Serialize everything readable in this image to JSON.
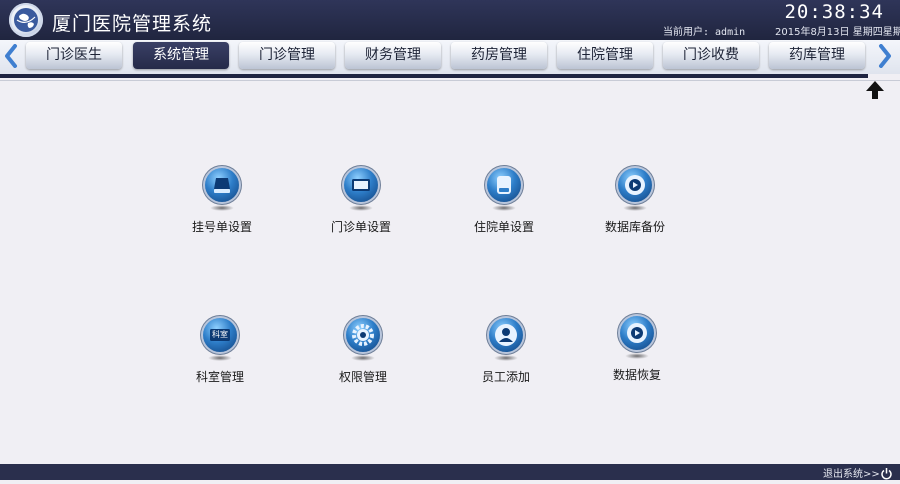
{
  "header": {
    "title": "厦门医院管理系统",
    "clock": "20:38:34",
    "user_info": "当前用户:  admin",
    "date_info": "2015年8月13日  星期四星期"
  },
  "nav": {
    "tabs": [
      {
        "label": "门诊医生",
        "active": false
      },
      {
        "label": "系统管理",
        "active": true
      },
      {
        "label": "门诊管理",
        "active": false
      },
      {
        "label": "财务管理",
        "active": false
      },
      {
        "label": "药房管理",
        "active": false
      },
      {
        "label": "住院管理",
        "active": false
      },
      {
        "label": "门诊收费",
        "active": false
      },
      {
        "label": "药库管理",
        "active": false
      }
    ]
  },
  "apps": [
    {
      "label": "挂号单设置",
      "icon": "register-form-icon"
    },
    {
      "label": "门诊单设置",
      "icon": "outpatient-form-icon"
    },
    {
      "label": "住院单设置",
      "icon": "inpatient-form-icon"
    },
    {
      "label": "数据库备份",
      "icon": "database-backup-icon"
    },
    {
      "label": "科室管理",
      "icon": "department-icon",
      "badge": "科室"
    },
    {
      "label": "权限管理",
      "icon": "permission-gear-icon"
    },
    {
      "label": "员工添加",
      "icon": "add-employee-icon"
    },
    {
      "label": "数据恢复",
      "icon": "data-restore-icon"
    }
  ],
  "footer": {
    "exit_label": "退出系统>>"
  },
  "colors": {
    "header_bg": "#262b48",
    "active_tab": "#2c3152",
    "accent_blue": "#2e7ec9",
    "page_bg": "#f0eff4"
  }
}
